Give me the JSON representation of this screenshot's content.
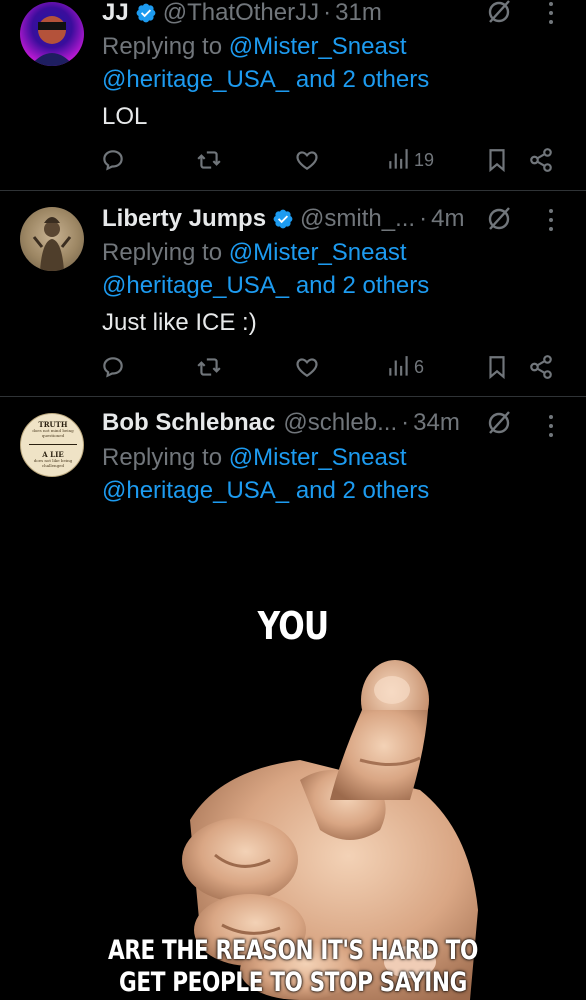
{
  "tweets": [
    {
      "name": "JJ",
      "handle": "@ThatOtherJJ",
      "time": "31m",
      "replying_prefix": "Replying to",
      "reply_to_1": "@Mister_Sneast",
      "reply_to_2": "@heritage_USA_",
      "reply_and": "and 2 others",
      "text": "LOL",
      "views": "19"
    },
    {
      "name": "Liberty Jumps",
      "handle": "@smith_...",
      "time": "4m",
      "replying_prefix": "Replying to",
      "reply_to_1": "@Mister_Sneast",
      "reply_to_2": "@heritage_USA_",
      "reply_and": "and 2 others",
      "text": "Just like ICE :)",
      "views": "6"
    },
    {
      "name": "Bob Schlebnac",
      "handle": "@schleb...",
      "time": "34m",
      "replying_prefix": "Replying to",
      "reply_to_1": "@Mister_Sneast",
      "reply_to_2": "@heritage_USA_",
      "reply_and": "and 2 others",
      "avatar_text_top": "TRUTH",
      "avatar_sub_top": "does not mind being questioned",
      "avatar_text_bottom": "A LIE",
      "avatar_sub_bottom": "does not like being challenged"
    }
  ],
  "meme": {
    "top_text": "YOU",
    "bottom_line_1": "ARE THE REASON IT'S HARD TO",
    "bottom_line_2": "GET PEOPLE TO STOP SAYING “RETARD”"
  },
  "separator": "·",
  "colors": {
    "background": "#000000",
    "link": "#1d9bf0",
    "muted": "#71767b",
    "text": "#e7e9ea",
    "verified": "#1d9bf0"
  },
  "icons": [
    "verified-badge-icon",
    "grok-icon",
    "more-icon",
    "reply-icon",
    "retweet-icon",
    "like-icon",
    "views-icon",
    "bookmark-icon",
    "share-icon"
  ]
}
